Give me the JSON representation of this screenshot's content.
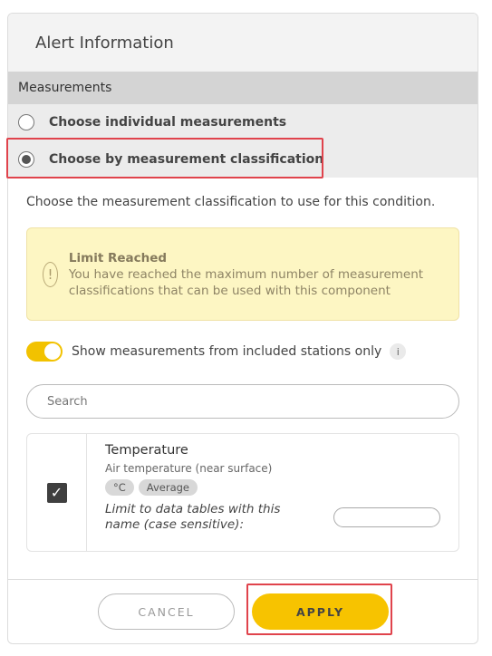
{
  "header": {
    "title": "Alert Information"
  },
  "section": {
    "title": "Measurements"
  },
  "options": [
    {
      "label": "Choose individual measurements",
      "selected": false
    },
    {
      "label": "Choose by measurement classification",
      "selected": true
    }
  ],
  "description": "Choose the measurement classification to use for this condition.",
  "alert": {
    "title": "Limit Reached",
    "message": "You have reached the maximum number of measurement classifications that can be used with this component",
    "icon": "exclamation-icon"
  },
  "toggle": {
    "label": "Show measurements from included stations only",
    "enabled": true,
    "info_glyph": "i"
  },
  "search": {
    "placeholder": "Search",
    "value": ""
  },
  "measurement": {
    "name": "Temperature",
    "description": "Air temperature (near surface)",
    "tags": [
      "°C",
      "Average"
    ],
    "checked": true,
    "limit_label": "Limit to data tables with this name (case sensitive):",
    "limit_value": ""
  },
  "footer": {
    "cancel_label": "CANCEL",
    "apply_label": "APPLY"
  },
  "colors": {
    "accent": "#f7c300",
    "highlight": "#e0434c",
    "alert_bg": "#fdf6c3"
  }
}
